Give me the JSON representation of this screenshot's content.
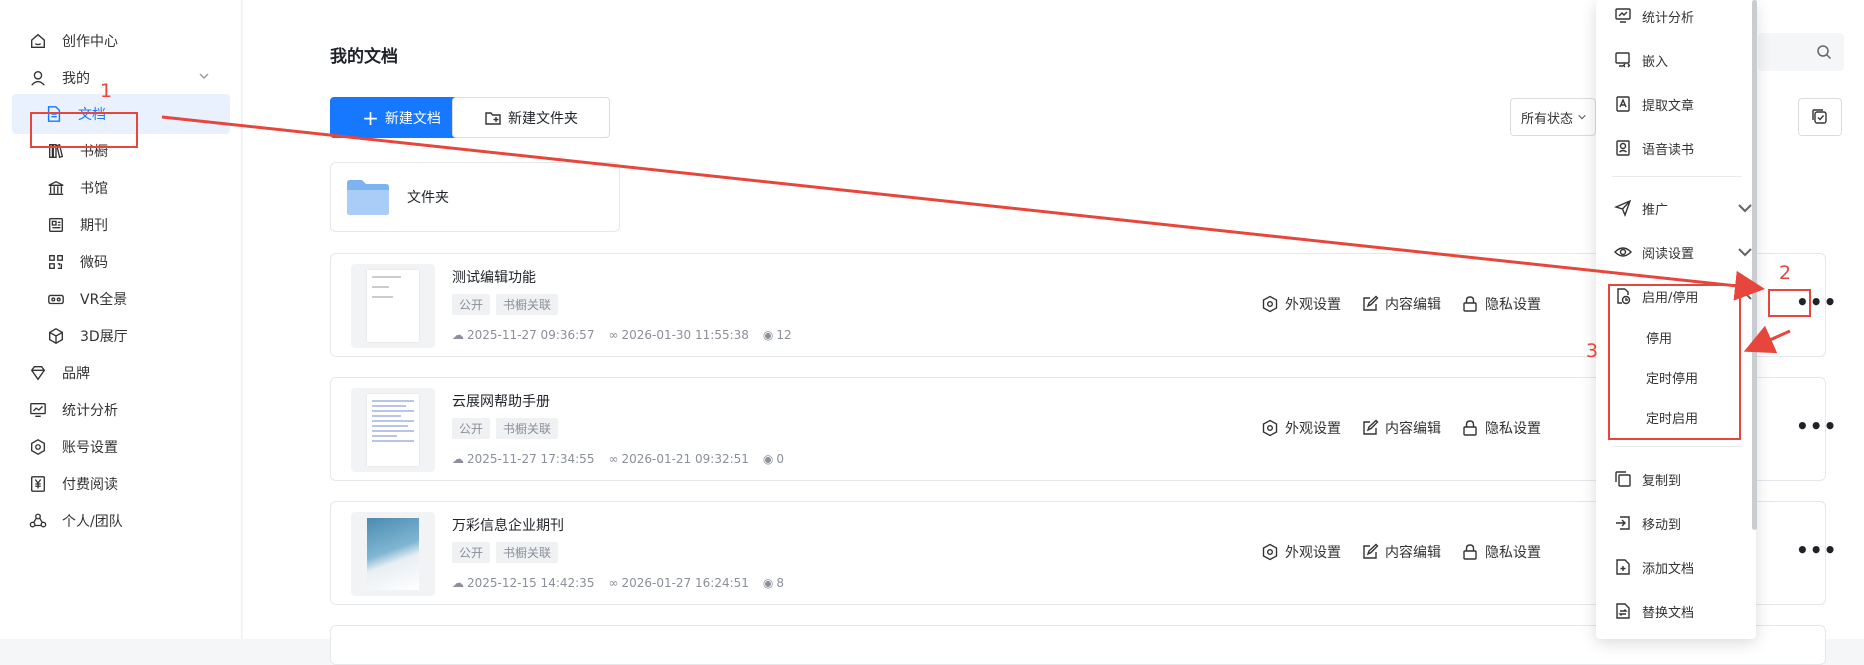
{
  "sidebar": {
    "items": [
      {
        "label": "创作中心",
        "icon": "home-icon"
      },
      {
        "label": "我的",
        "icon": "user-icon"
      },
      {
        "label": "文档",
        "icon": "document-icon"
      },
      {
        "label": "书橱",
        "icon": "bookshelf-icon"
      },
      {
        "label": "书馆",
        "icon": "library-icon"
      },
      {
        "label": "期刊",
        "icon": "journal-icon"
      },
      {
        "label": "微码",
        "icon": "qrcode-icon"
      },
      {
        "label": "VR全景",
        "icon": "vr-icon"
      },
      {
        "label": "3D展厅",
        "icon": "cube-icon"
      },
      {
        "label": "品牌",
        "icon": "diamond-icon"
      },
      {
        "label": "统计分析",
        "icon": "chart-icon"
      },
      {
        "label": "账号设置",
        "icon": "settings-icon"
      },
      {
        "label": "付费阅读",
        "icon": "yen-icon"
      },
      {
        "label": "个人/团队",
        "icon": "team-icon"
      }
    ]
  },
  "main": {
    "title": "我的文档",
    "new_doc": "新建文档",
    "new_folder": "新建文件夹",
    "filter": "所有状态",
    "folder_name": "文件夹"
  },
  "documents": [
    {
      "name": "测试编辑功能",
      "tags": [
        "公开",
        "书橱关联"
      ],
      "created": "2025-11-27 09:36:57",
      "modified": "2026-01-30 11:55:38",
      "views": "12"
    },
    {
      "name": "云展网帮助手册",
      "tags": [
        "公开",
        "书橱关联"
      ],
      "created": "2025-11-27 17:34:55",
      "modified": "2026-01-21 09:32:51",
      "views": "0"
    },
    {
      "name": "万彩信息企业期刊",
      "tags": [
        "公开",
        "书橱关联"
      ],
      "created": "2025-12-15 14:42:35",
      "modified": "2026-01-27 16:24:51",
      "views": "8"
    }
  ],
  "actions": {
    "appearance": "外观设置",
    "edit": "内容编辑",
    "privacy": "隐私设置",
    "more": "•••"
  },
  "menu": {
    "stats": "统计分析",
    "embed": "嵌入",
    "extract": "提取文章",
    "voice": "语音读书",
    "promote": "推广",
    "read_settings": "阅读设置",
    "enable_disable": "启用/停用",
    "sub": [
      "停用",
      "定时停用",
      "定时启用"
    ],
    "copy_to": "复制到",
    "move_to": "移动到",
    "add_doc": "添加文档",
    "replace_doc": "替换文档"
  },
  "annotations": {
    "n1": "1",
    "n2": "2",
    "n3": "3",
    "color": "#e6463b"
  },
  "colors": {
    "primary": "#1677ff",
    "active_bg": "#e8f1fd"
  }
}
